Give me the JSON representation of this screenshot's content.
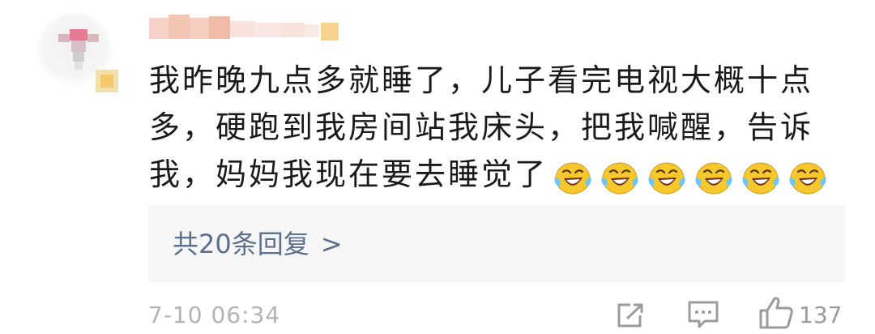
{
  "comment": {
    "lines": [
      "我昨晚九点多就睡了，儿子看完电视大概十点",
      "多，硬跑到我房间站我床头，把我喊醒，告诉",
      "我，妈妈我现在要去睡觉了"
    ],
    "emoji_count": 6,
    "emoji_name": "laughing-crying-emoji"
  },
  "replies": {
    "label": "共20条回复",
    "chevron": ">"
  },
  "meta": {
    "date": "7-10 06:34",
    "like_count": "137"
  },
  "colors": {
    "text": "#1a1a1a",
    "reply_link": "#5b6f8c",
    "meta_text": "#b3b3b3",
    "reply_bg": "#f6f6f6",
    "emoji_yellow": "#f7c82e"
  }
}
